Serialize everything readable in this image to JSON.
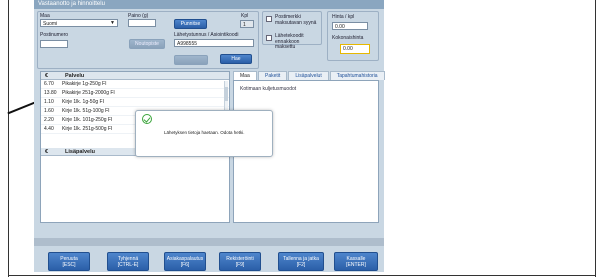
{
  "app": {
    "title": "Vastaanotto ja hinnoittelu"
  },
  "header": {
    "maa_label": "Maa",
    "maa_value": "Suomi",
    "paino_label": "Paino (g)",
    "punnitse_label": "Punnitse",
    "kpl_label": "Kpl",
    "kpl_value": "1",
    "postinumero_label": "Postinumero",
    "postinumero_value": "",
    "noutopiste_label": "Noutopiste",
    "lahetystunnus_label": "Lähetystunnus / Asiointikoodi",
    "lahetystunnus_value": "A998555",
    "hae_label": "Hae",
    "postimerkki_label": "Postimerkki maksutavan syynä",
    "lahetekoodit_label": "Lähetekoodit ennakkoon maksettu",
    "hinta_label": "Hinta / kpl",
    "hinta_value": "0.00",
    "kokonaishinta_label": "Kokonaishinta",
    "kokonaishinta_value": "0.00"
  },
  "left_panel": {
    "currency_header": "€",
    "palvelu_header": "Palvelu",
    "rows": [
      {
        "price": "6.70",
        "name": "Pikakirje 1g-250g FI"
      },
      {
        "price": "13.80",
        "name": "Pikakirje 251g-2000g FI"
      },
      {
        "price": "1.10",
        "name": "Kirje 1lk. 1g-50g FI"
      },
      {
        "price": "1.60",
        "name": "Kirje 1lk. 51g-100g FI"
      },
      {
        "price": "2.20",
        "name": "Kirje 1lk. 101g-250g FI"
      },
      {
        "price": "4.40",
        "name": "Kirje 1lk. 251g-500g FI"
      }
    ],
    "lisapalvelu_currency": "€",
    "lisapalvelu_header": "Lisäpalvelu"
  },
  "tabs": [
    {
      "label": "Maa / Alue"
    },
    {
      "label": "Paketit"
    },
    {
      "label": "Lisäpalvelut"
    },
    {
      "label": "Tapahtumahistoria"
    }
  ],
  "right_panel": {
    "text": "Kotimaan kuljetusmuodot"
  },
  "dialog": {
    "message": "Lähetyksen tietoja haetaan. Odota hetki."
  },
  "footer": {
    "buttons": [
      {
        "line1": "Peruuta",
        "line2": "[ESC]"
      },
      {
        "line1": "Tyhjennä",
        "line2": "[CTRL-E]"
      },
      {
        "line1": "Asiakaspalautus",
        "line2": "[F6]"
      },
      {
        "line1": "Rekisteröinti",
        "line2": "[F9]"
      },
      {
        "line1": "Tallenna ja jatka",
        "line2": "[F2]"
      },
      {
        "line1": "Kassalle",
        "line2": "[ENTER]"
      }
    ]
  },
  "colors": {
    "app_background": "#c9d7e3",
    "button_blue": "#2b5fa8",
    "success_green": "#3ba53b",
    "highlight_yellow": "#e6b800"
  }
}
